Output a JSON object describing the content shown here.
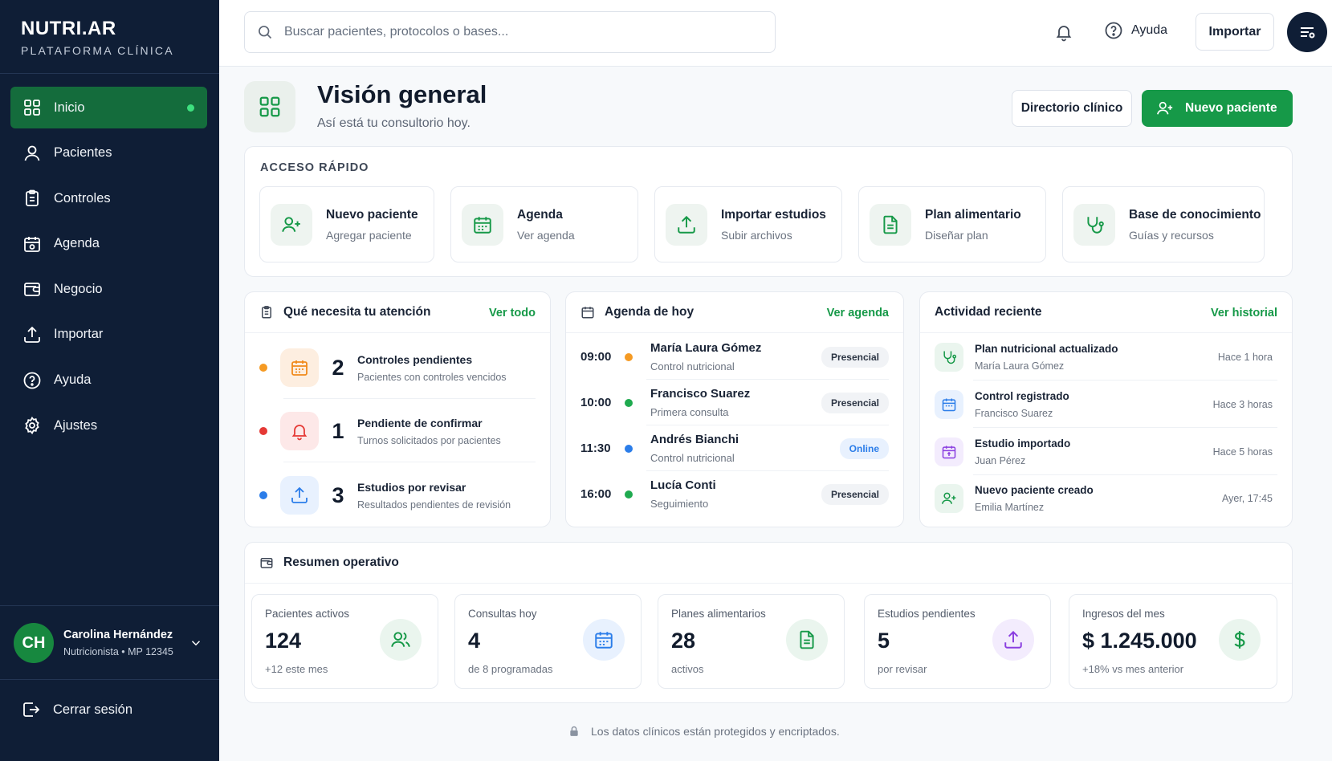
{
  "brand": {
    "name": "NUTRI.AR",
    "subtitle": "PLATAFORMA CLÍNICA"
  },
  "sidebar": {
    "items": [
      {
        "label": "Inicio",
        "icon": "grid-icon",
        "active": true
      },
      {
        "label": "Pacientes",
        "icon": "user-icon"
      },
      {
        "label": "Controles",
        "icon": "clipboard-icon"
      },
      {
        "label": "Agenda",
        "icon": "calendar-icon"
      },
      {
        "label": "Negocio",
        "icon": "wallet-icon"
      },
      {
        "label": "Importar",
        "icon": "upload-icon"
      },
      {
        "label": "Ayuda",
        "icon": "help-icon"
      },
      {
        "label": "Ajustes",
        "icon": "gear-icon"
      }
    ],
    "user": {
      "initials": "CH",
      "name": "Carolina Hernández",
      "role": "Nutricionista • MP 12345"
    },
    "logout_label": "Cerrar sesión"
  },
  "topbar": {
    "search_placeholder": "Buscar pacientes, protocolos o bases...",
    "help_label": "Ayuda",
    "import_label": "Importar"
  },
  "header": {
    "title": "Visión general",
    "subtitle": "Así está tu consultorio hoy.",
    "directory_button": "Directorio clínico",
    "new_patient_button": "Nuevo paciente"
  },
  "quick_access": {
    "label": "ACCESO RÁPIDO",
    "items": [
      {
        "title": "Nuevo paciente",
        "subtitle": "Agregar paciente",
        "icon": "user-plus-icon"
      },
      {
        "title": "Agenda",
        "subtitle": "Ver agenda",
        "icon": "calendar-icon"
      },
      {
        "title": "Importar estudios",
        "subtitle": "Subir archivos",
        "icon": "upload-icon"
      },
      {
        "title": "Plan alimentario",
        "subtitle": "Diseñar plan",
        "icon": "document-icon"
      },
      {
        "title": "Base de conocimiento",
        "subtitle": "Guías y recursos",
        "icon": "stethoscope-icon"
      }
    ]
  },
  "attention": {
    "title": "Qué necesita tu atención",
    "link": "Ver todo",
    "items": [
      {
        "count": "2",
        "title": "Controles pendientes",
        "subtitle": "Pacientes con controles vencidos",
        "color": "#f59a23",
        "icon": "calendar-icon"
      },
      {
        "count": "1",
        "title": "Pendiente de confirmar",
        "subtitle": "Turnos solicitados por pacientes",
        "color": "#e53935",
        "icon": "bell-icon"
      },
      {
        "count": "3",
        "title": "Estudios por revisar",
        "subtitle": "Resultados pendientes de revisión",
        "color": "#2b7de9",
        "icon": "upload-icon"
      }
    ]
  },
  "agenda": {
    "title": "Agenda de hoy",
    "link": "Ver agenda",
    "items": [
      {
        "time": "09:00",
        "name": "María Laura Gómez",
        "type": "Control nutricional",
        "mode": "Presencial",
        "color": "#f59a23"
      },
      {
        "time": "10:00",
        "name": "Francisco Suarez",
        "type": "Primera consulta",
        "mode": "Presencial",
        "color": "#1faa4f"
      },
      {
        "time": "11:30",
        "name": "Andrés Bianchi",
        "type": "Control nutricional",
        "mode": "Online",
        "color": "#2b7de9"
      },
      {
        "time": "16:00",
        "name": "Lucía Conti",
        "type": "Seguimiento",
        "mode": "Presencial",
        "color": "#1faa4f"
      }
    ]
  },
  "activity": {
    "title": "Actividad reciente",
    "link": "Ver historial",
    "items": [
      {
        "title": "Plan nutricional actualizado",
        "subtitle": "María Laura Gómez",
        "time": "Hace 1 hora",
        "icon": "stethoscope-icon"
      },
      {
        "title": "Control registrado",
        "subtitle": "Francisco Suarez",
        "time": "Hace 3 horas",
        "icon": "calendar-icon"
      },
      {
        "title": "Estudio importado",
        "subtitle": "Juan Pérez",
        "time": "Hace 5 horas",
        "icon": "calendar-upload-icon"
      },
      {
        "title": "Nuevo paciente creado",
        "subtitle": "Emilia Martínez",
        "time": "Ayer, 17:45",
        "icon": "user-plus-icon"
      }
    ]
  },
  "summary": {
    "title": "Resumen operativo",
    "stats": [
      {
        "label": "Pacientes activos",
        "value": "124",
        "sub": "+12 este mes",
        "icon": "users-icon"
      },
      {
        "label": "Consultas hoy",
        "value": "4",
        "sub": "de 8 programadas",
        "icon": "calendar-icon"
      },
      {
        "label": "Planes alimentarios",
        "value": "28",
        "sub": "activos",
        "icon": "document-icon"
      },
      {
        "label": "Estudios pendientes",
        "value": "5",
        "sub": "por revisar",
        "icon": "upload-icon"
      },
      {
        "label": "Ingresos del mes",
        "value": "$ 1.245.000",
        "sub": "+18% vs mes anterior",
        "icon": "dollar-icon"
      }
    ]
  },
  "footer_note": "Los datos clínicos están protegidos y encriptados.",
  "colors": {
    "sidebar": "#0f1e36",
    "accent": "#169948",
    "active_nav": "#146c3c"
  }
}
